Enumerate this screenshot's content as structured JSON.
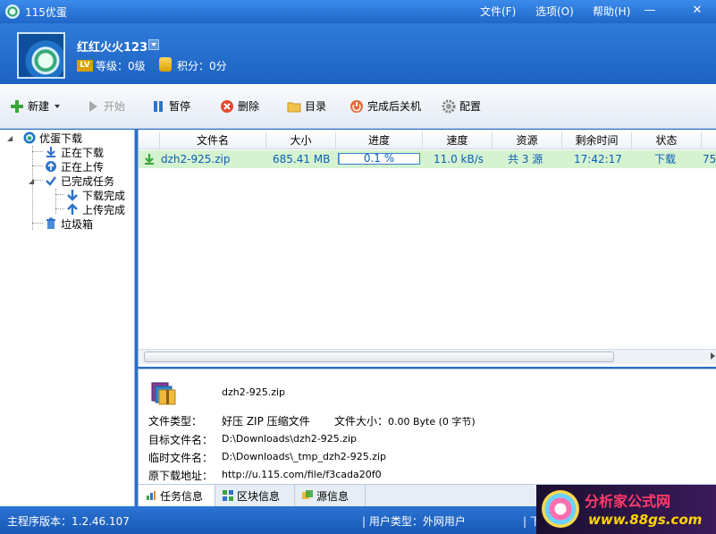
{
  "window": {
    "title": "115优蛋",
    "menus": [
      "文件(F)",
      "选项(O)",
      "帮助(H)"
    ],
    "controls": [
      "—",
      "✕"
    ]
  },
  "user": {
    "name": "红红火火123",
    "lv_badge": "LV",
    "level": "等级：0级",
    "points": "积分：0分"
  },
  "toolbar": {
    "new_label": "新建",
    "start_label": "开始",
    "pause_label": "暂停",
    "delete_label": "删除",
    "folder_label": "目录",
    "shutdown_label": "完成后关机",
    "settings_label": "配置"
  },
  "tree": {
    "root": "优蛋下载",
    "downloading": "正在下载",
    "uploading": "正在上传",
    "completed": "已完成任务",
    "download_done": "下载完成",
    "upload_done": "上传完成",
    "trash": "垃圾箱"
  },
  "table": {
    "headers": [
      "文件名",
      "大小",
      "进度",
      "速度",
      "资源",
      "剩余时间",
      "状态"
    ],
    "rows": [
      {
        "name": "dzh2-925.zip",
        "size": "685.41 MB",
        "progress": 0.001,
        "progress_text": "0.1 %",
        "speed": "11.0 kB/s",
        "sources": "共 3 源",
        "remaining": "17:42:17",
        "status": "下载",
        "extra": "75"
      }
    ]
  },
  "detail": {
    "file_name": "dzh2-925.zip",
    "type_label": "文件类型：",
    "type_value": "好压 ZIP 压缩文件",
    "size_label": "文件大小：",
    "size_value": "0.00 Byte (0 字节)",
    "target_label": "目标文件名：",
    "target_value": "D:\\Downloads\\dzh2-925.zip",
    "temp_label": "临时文件名：",
    "temp_value": "D:\\Downloads\\_tmp_dzh2-925.zip",
    "url_label": "原下载地址：",
    "url_value": "http://u.115.com/file/f3cada20f0",
    "tabs": [
      "任务信息",
      "区块信息",
      "源信息"
    ]
  },
  "status": {
    "version": "主程序版本：1.2.46.107",
    "user_type": "| 用户类型：外网用户",
    "download": "| 下"
  },
  "watermark": {
    "title": "分析家公式网",
    "url": "www.88gs.com"
  }
}
